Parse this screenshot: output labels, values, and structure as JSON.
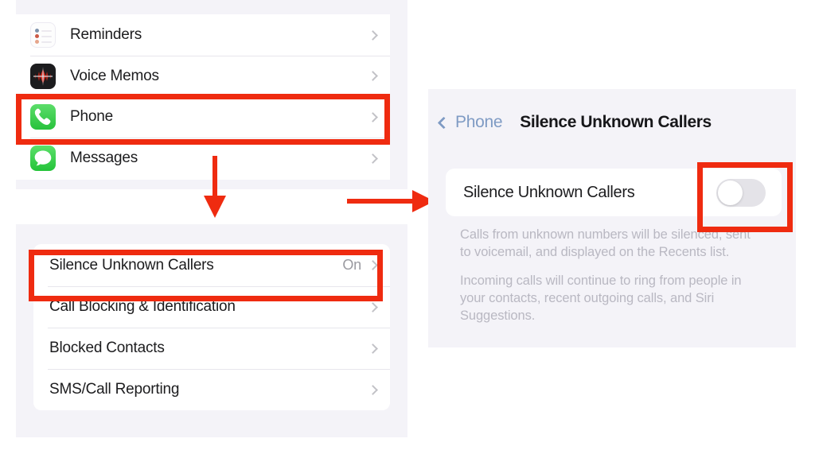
{
  "colors": {
    "annotation_red": "#ef2b10",
    "panel_background": "#f4f3f8",
    "accent_green": "#28c23c",
    "back_link_blue": "#7f9bc4",
    "page_background": "#ffffff"
  },
  "settings_panel": {
    "name": "iOS Settings app list",
    "rows": [
      {
        "icon": "reminders-app-icon",
        "label": "Reminders",
        "value": "",
        "accessory": "chevron-right-icon",
        "highlighted": false
      },
      {
        "icon": "voice-memos-app-icon",
        "label": "Voice Memos",
        "value": "",
        "accessory": "chevron-right-icon",
        "highlighted": false
      },
      {
        "icon": "phone-app-icon",
        "label": "Phone",
        "value": "",
        "accessory": "chevron-right-icon",
        "highlighted": true
      },
      {
        "icon": "messages-app-icon",
        "label": "Messages",
        "value": "",
        "accessory": "chevron-right-icon",
        "highlighted": false
      }
    ]
  },
  "phone_settings_panel": {
    "name": "Phone settings list",
    "rows": [
      {
        "label": "Silence Unknown Callers",
        "value": "On",
        "accessory": "chevron-right-icon",
        "highlighted": true
      },
      {
        "label": "Call Blocking & Identification",
        "value": "",
        "accessory": "chevron-right-icon",
        "highlighted": false
      },
      {
        "label": "Blocked Contacts",
        "value": "",
        "accessory": "chevron-right-icon",
        "highlighted": false
      },
      {
        "label": "SMS/Call Reporting",
        "value": "",
        "accessory": "chevron-right-icon",
        "highlighted": false
      }
    ]
  },
  "detail_panel": {
    "navbar": {
      "back_icon": "chevron-left-icon",
      "back_label": "Phone",
      "title": "Silence Unknown Callers"
    },
    "toggle_row": {
      "label": "Silence Unknown Callers",
      "switch_state": "off",
      "highlighted": true
    },
    "footnotes": [
      "Calls from unknown numbers will be silenced, sent to voicemail, and displayed on the Recents list.",
      "Incoming calls will continue to ring from people in your contacts, recent outgoing calls, and Siri Suggestions."
    ]
  },
  "annotations": {
    "arrow_down": "arrow-down-icon",
    "arrow_right": "arrow-right-icon"
  }
}
